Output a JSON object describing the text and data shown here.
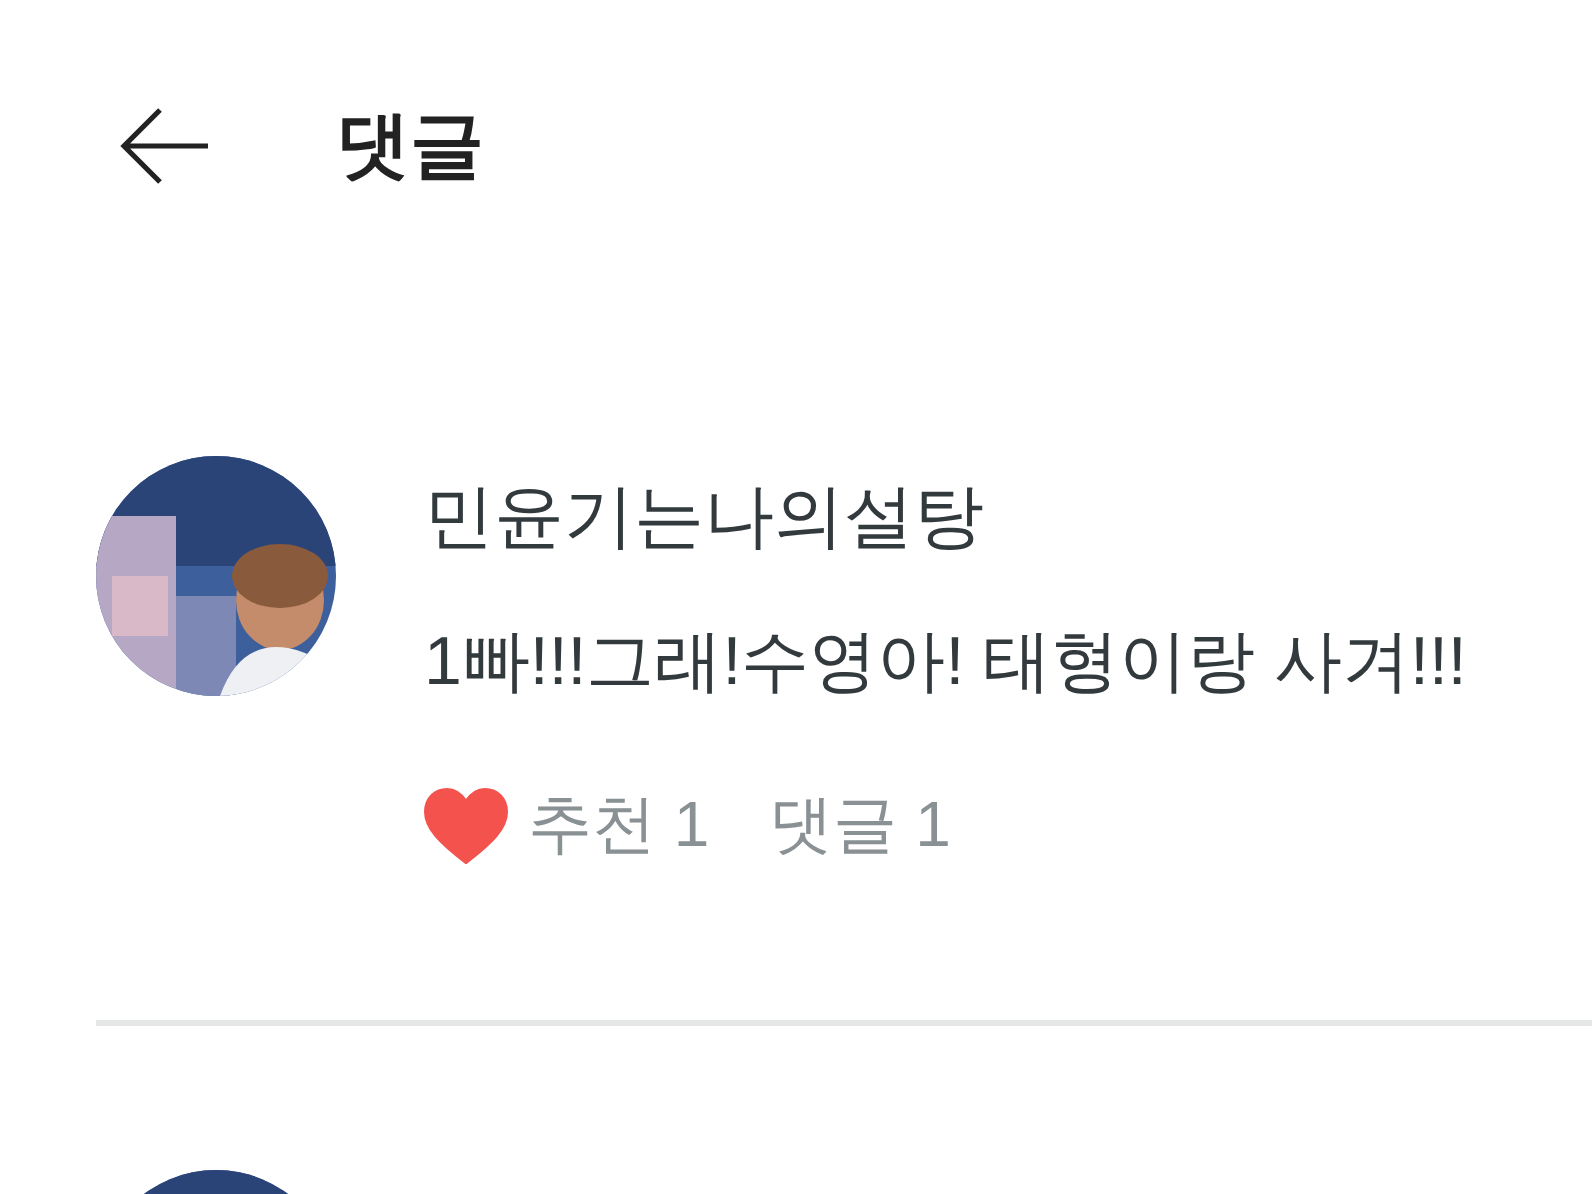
{
  "header": {
    "title": "댓글"
  },
  "comments": [
    {
      "avatar": {
        "kind": "picture"
      },
      "author": "민윤기는나의설탕",
      "text": "1빠!!!그래!수영아! 태형이랑 사겨!!!",
      "liked": true,
      "likes": "추천 1",
      "replies": "댓글 1"
    },
    {
      "avatar": {
        "kind": "picture"
      }
    }
  ]
}
